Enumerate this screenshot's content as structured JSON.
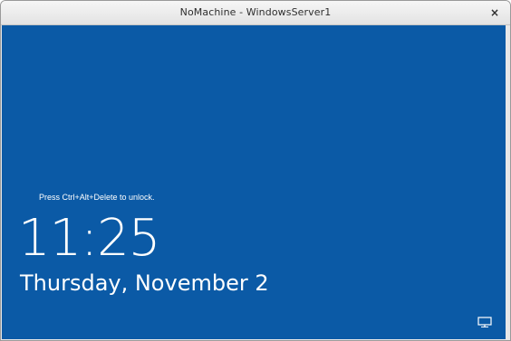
{
  "window": {
    "title": "NoMachine - WindowsServer1",
    "close_glyph": "×"
  },
  "lock_screen": {
    "hint": "Press Ctrl+Alt+Delete to unlock.",
    "time": "11:25",
    "date": "Thursday, November 2",
    "background_color": "#0b5aa6",
    "status_icon": "network-icon"
  }
}
